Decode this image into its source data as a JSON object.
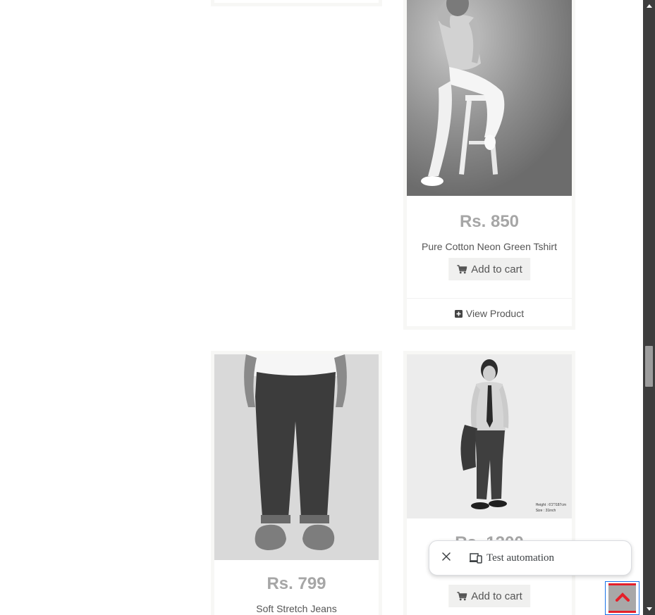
{
  "products": [
    {
      "price": "Rs. 850",
      "name": "Pure Cotton Neon Green Tshirt",
      "cart_label": "Add to cart",
      "view_label": "View Product"
    },
    {
      "price": "Rs. 799",
      "name": "Soft Stretch Jeans"
    },
    {
      "price": "Rs. 1200",
      "cart_label": "Add to cart",
      "photo_caption_1": "Height : 6'2\"/187cm",
      "photo_caption_2": "Size : 31inch"
    }
  ],
  "floating_pill": {
    "label": "Test automation"
  },
  "icons": {
    "cart": "shopping-cart-icon",
    "view": "plus-square-icon",
    "close": "close-icon",
    "devices": "devices-icon",
    "scroll_top": "chevron-up-icon"
  },
  "colors": {
    "price": "#a6a6a6",
    "button_bg": "#f0f0ef",
    "card_border": "#f7f7f5",
    "scroll_top_accent": "#e5202a",
    "scrollbar": "#3d3d3d"
  }
}
